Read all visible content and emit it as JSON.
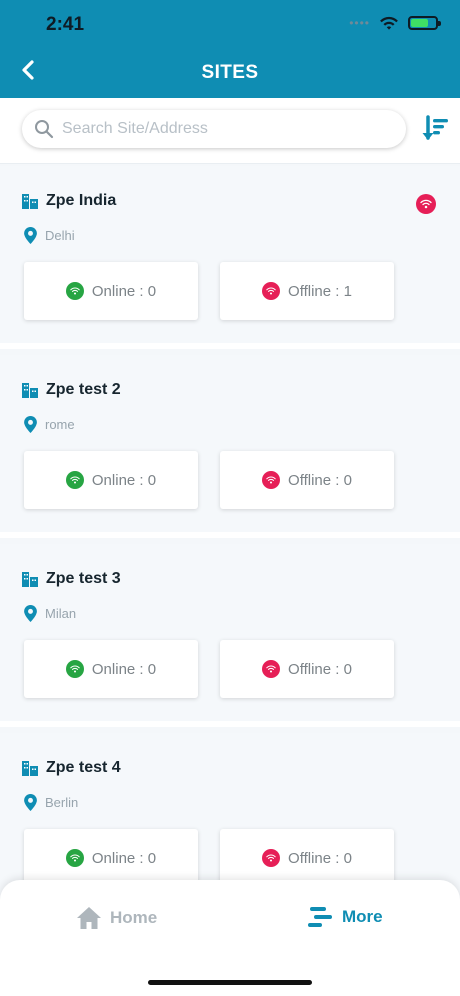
{
  "status_bar": {
    "time": "2:41"
  },
  "header": {
    "title": "SITES"
  },
  "search": {
    "placeholder": "Search Site/Address",
    "value": ""
  },
  "sites": [
    {
      "name": "Zpe India",
      "location": "Delhi",
      "online_label": "Online : 0",
      "offline_label": "Offline : 1",
      "status_badge": "offline"
    },
    {
      "name": "Zpe test 2",
      "location": "rome",
      "online_label": "Online : 0",
      "offline_label": "Offline : 0"
    },
    {
      "name": "Zpe test 3",
      "location": "Milan",
      "online_label": "Online : 0",
      "offline_label": "Offline : 0"
    },
    {
      "name": "Zpe test 4",
      "location": "Berlin",
      "online_label": "Online : 0",
      "offline_label": "Offline : 0"
    }
  ],
  "bottom_nav": {
    "home_label": "Home",
    "more_label": "More"
  },
  "colors": {
    "primary": "#0f8db3",
    "online": "#27a543",
    "offline": "#e61f57",
    "inactive": "#aeb6bc"
  },
  "icons": {
    "back": "chevron-left-icon",
    "search": "search-icon",
    "sort": "sort-icon",
    "building": "building-icon",
    "location": "location-pin-icon",
    "wifi": "wifi-icon",
    "home": "home-icon",
    "more": "menu-icon"
  }
}
